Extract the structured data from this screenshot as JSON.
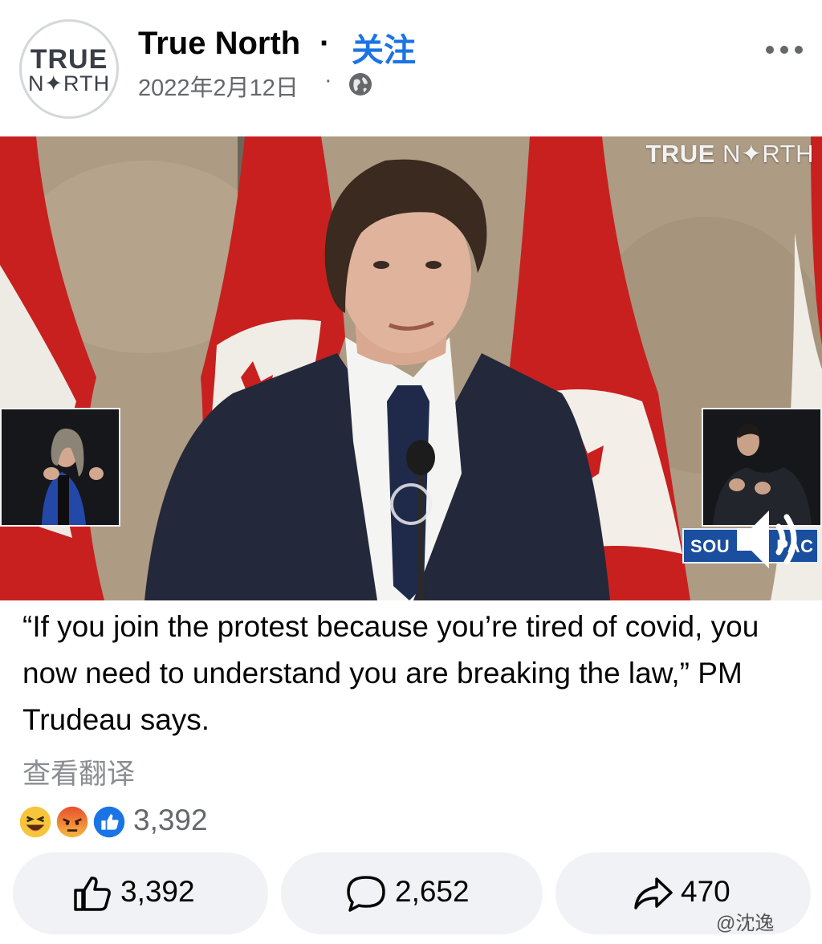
{
  "post": {
    "avatar": {
      "line1": "TRUE",
      "line2": "N✦RTH"
    },
    "page_name": "True North",
    "separator": "·",
    "follow_label": "关注",
    "date": "2022年2月12日",
    "date_separator": "·",
    "privacy_icon": "globe-icon",
    "more_icon": "more-dots-icon"
  },
  "video": {
    "watermark_bold": "TRUE",
    "watermark_light": " N✦RTH",
    "source_tag": "SOU",
    "source_tag_end": "PAC",
    "speaker_icon": "speaker-icon"
  },
  "caption": {
    "text": "“If you join the protest because you’re tired of covid, you now need to understand you are breaking the law,” PM Trudeau says.",
    "translate_label": "查看翻译"
  },
  "reactions": {
    "icons": [
      "haha-reaction-icon",
      "angry-reaction-icon",
      "like-reaction-icon"
    ],
    "total": "3,392"
  },
  "actions": {
    "like_count": "3,392",
    "comment_count": "2,652",
    "share_count": "470"
  },
  "watermark_corner": "@沈逸",
  "colors": {
    "accent": "#1b74e4",
    "secondary_text": "#65676b",
    "button_bg": "#f0f2f5"
  }
}
